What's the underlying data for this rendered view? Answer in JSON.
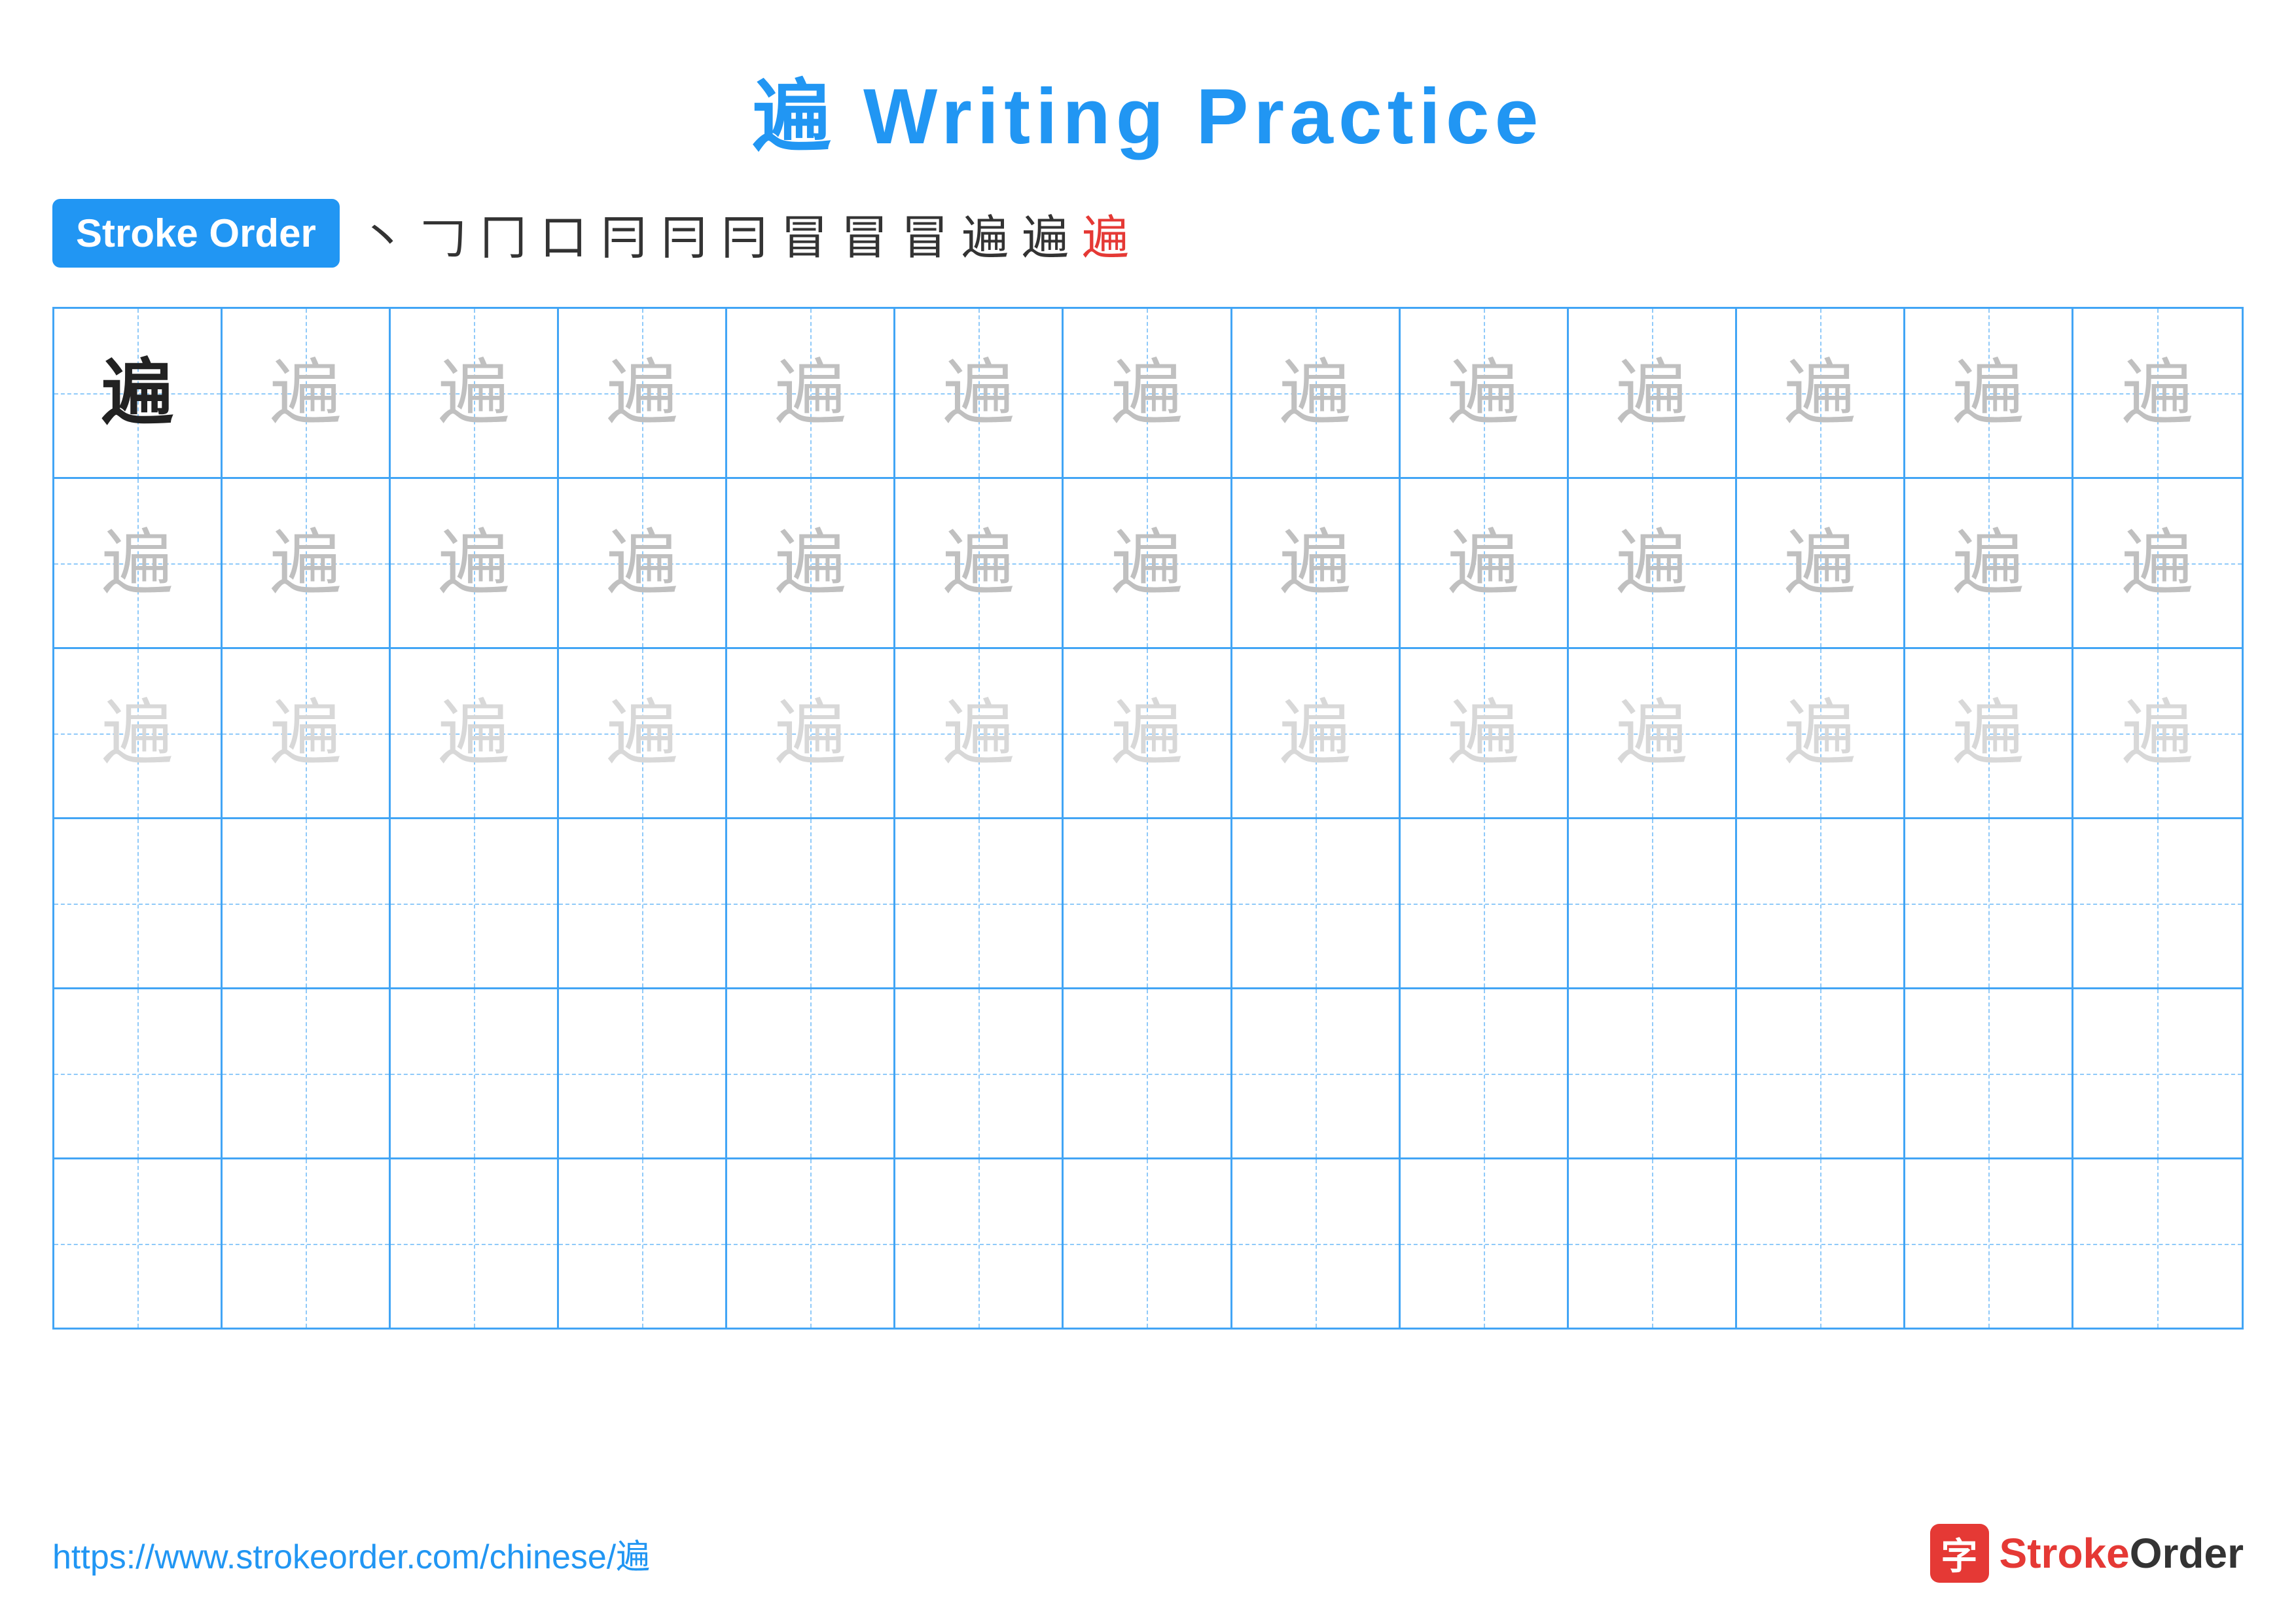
{
  "title": "遍 Writing Practice",
  "stroke_order": {
    "badge_label": "Stroke Order",
    "strokes": [
      "丶",
      "𠃌",
      "冂",
      "口",
      "冃",
      "冃",
      "冃",
      "冒",
      "冒",
      "冒",
      "遍",
      "遍",
      "遍"
    ],
    "red_indices": [
      12
    ]
  },
  "character": "遍",
  "grid": {
    "rows": 6,
    "cols": 13,
    "row_types": [
      "solid-then-medium",
      "medium",
      "light",
      "empty",
      "empty",
      "empty"
    ]
  },
  "footer": {
    "url": "https://www.strokeorder.com/chinese/遍",
    "logo_char": "字",
    "logo_text": "StrokeOrder"
  }
}
